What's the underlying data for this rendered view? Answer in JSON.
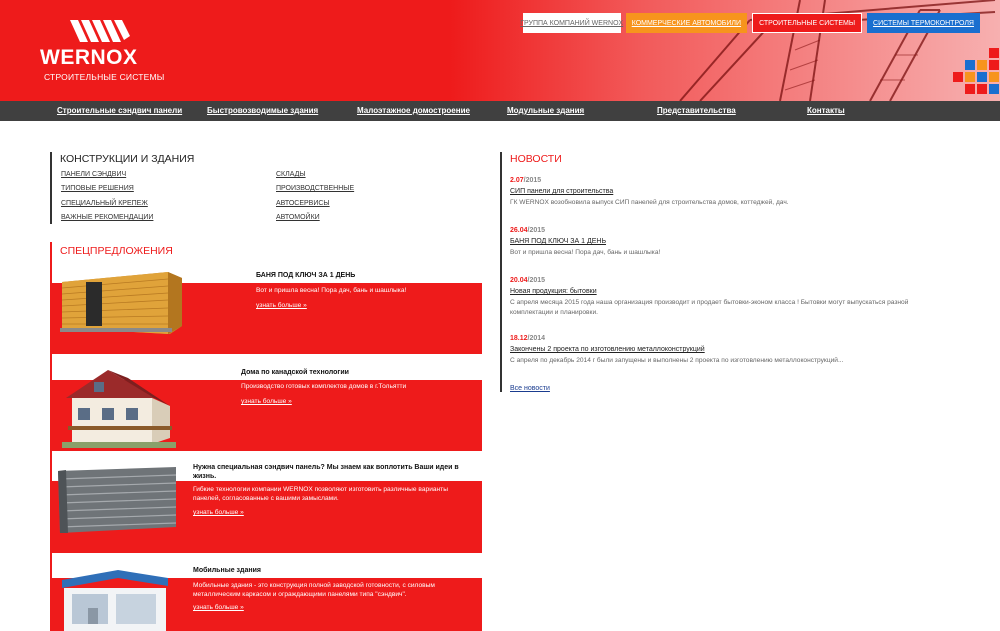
{
  "brand": {
    "name": "WERNOX",
    "subtitle": "СТРОИТЕЛЬНЫЕ СИСТЕМЫ",
    "color": "#ee1b1b"
  },
  "top_links": [
    {
      "label": "ГРУППА КОМПАНИЙ WERNOX"
    },
    {
      "label": "КОММЕРЧЕСКИЕ АВТОМОБИЛИ"
    },
    {
      "label": "СТРОИТЕЛЬНЫЕ СИСТЕМЫ"
    },
    {
      "label": "СИСТЕМЫ ТЕРМОКОНТРОЛЯ"
    }
  ],
  "nav": [
    {
      "label": "Строительные сэндвич панели"
    },
    {
      "label": "Быстровозводимые здания"
    },
    {
      "label": "Малоэтажное домостроение"
    },
    {
      "label": "Модульные здания"
    },
    {
      "label": "Представительства"
    },
    {
      "label": "Контакты"
    }
  ],
  "constructions": {
    "heading": "КОНСТРУКЦИИ И ЗДАНИЯ",
    "col1": [
      "ПАНЕЛИ СЭНДВИЧ",
      "ТИПОВЫЕ РЕШЕНИЯ",
      "СПЕЦИАЛЬНЫЙ КРЕПЕЖ",
      "ВАЖНЫЕ РЕКОМЕНДАЦИИ"
    ],
    "col2": [
      "СКЛАДЫ",
      "ПРОИЗВОДСТВЕННЫЕ",
      "АВТОСЕРВИСЫ",
      "АВТОМОЙКИ"
    ]
  },
  "special_offers": {
    "heading": "СПЕЦПРЕДЛОЖЕНИЯ",
    "items": [
      {
        "title": "БАНЯ ПОД КЛЮЧ ЗА 1 ДЕНЬ",
        "text": "Вот и пришла весна! Пора дач, бань и шашлыка!",
        "more": "узнать больше »",
        "icon": "sauna-cabin-icon"
      },
      {
        "title": "Дома по канадской технологии",
        "text": "Производство готовых комплектов домов в г.Тольятти",
        "more": "узнать больше »",
        "icon": "house-icon"
      },
      {
        "title": "Нужна специальная сэндвич панель? Мы знаем как воплотить Ваши идеи в жизнь.",
        "text": "Гибкие технологии компании WERNOX позволяют изготовить различные варианты панелей, согласованные с вашими замыслами.",
        "more": "узнать больше »",
        "icon": "sandwich-panels-icon"
      },
      {
        "title": "Мобильные здания",
        "text": "Мобильные здания - это конструкция полной заводской готовности, с силовым металлическим каркасом и ограждающими панелями типа \"сэндвич\".",
        "more": "узнать больше »",
        "icon": "mobile-building-icon"
      }
    ]
  },
  "news": {
    "heading": "НОВОСТИ",
    "items": [
      {
        "day": "2.07",
        "year": "/2015",
        "title": "СИП панели для строительства",
        "text": "ГК WERNOX возобновила выпуск СИП панелей для строительства домов, коттеджей, дач."
      },
      {
        "day": "26.04",
        "year": "/2015",
        "title": "БАНЯ ПОД КЛЮЧ ЗА 1 ДЕНЬ",
        "text": "Вот и пришла весна! Пора дач, бань и шашлыка!"
      },
      {
        "day": "20.04",
        "year": "/2015",
        "title": "Новая продукция: бытовки",
        "text": "С апреля месяца 2015 года наша организация производит и продает бытовки-эконом класса ! Бытовки могут выпускаться разной комплектации и планировки."
      },
      {
        "day": "18.12",
        "year": "/2014",
        "title": "Закончены 2 проекта по изготовлению металлоконструкций",
        "text": "С апреля по декабрь 2014 г были запущены и выполнены 2 проекта по изготовлению металлоконструкций..."
      }
    ],
    "all_link": "Все новости"
  }
}
